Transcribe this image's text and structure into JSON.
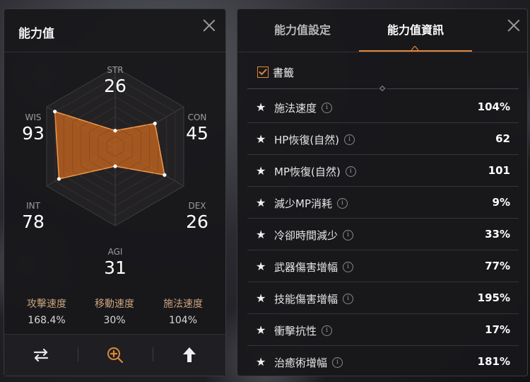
{
  "left_panel": {
    "title": "能力值",
    "stats": [
      {
        "key": "STR",
        "value": 26
      },
      {
        "key": "CON",
        "value": 45
      },
      {
        "key": "DEX",
        "value": 26
      },
      {
        "key": "AGI",
        "value": 31
      },
      {
        "key": "INT",
        "value": 78
      },
      {
        "key": "WIS",
        "value": 93
      }
    ],
    "radar_levels": [
      0.2,
      0.58,
      0.72,
      0.25,
      0.82,
      0.88
    ],
    "speeds": [
      {
        "label": "攻擊速度",
        "value": "168.4%"
      },
      {
        "label": "移動速度",
        "value": "30%"
      },
      {
        "label": "施法速度",
        "value": "104%"
      }
    ],
    "bottom_icons": [
      "swap-icon",
      "zoom-in-icon",
      "upload-arrow-icon"
    ]
  },
  "right_panel": {
    "tabs": [
      "能力值設定",
      "能力值資訊"
    ],
    "active_tab": 1,
    "bookmark_label": "書籤",
    "bookmark_checked": true,
    "rows": [
      {
        "label": "施法速度",
        "value": "104%"
      },
      {
        "label": "HP恢復(自然)",
        "value": "62"
      },
      {
        "label": "MP恢復(自然)",
        "value": "101"
      },
      {
        "label": "減少MP消耗",
        "value": "9%"
      },
      {
        "label": "冷卻時間減少",
        "value": "33%"
      },
      {
        "label": "武器傷害增幅",
        "value": "77%"
      },
      {
        "label": "技能傷害增幅",
        "value": "195%"
      },
      {
        "label": "衝擊抗性",
        "value": "17%"
      },
      {
        "label": "治癒術增幅",
        "value": "181%"
      }
    ]
  },
  "colors": {
    "accent": "#e0873a",
    "radar_fill": "#c8661f"
  }
}
